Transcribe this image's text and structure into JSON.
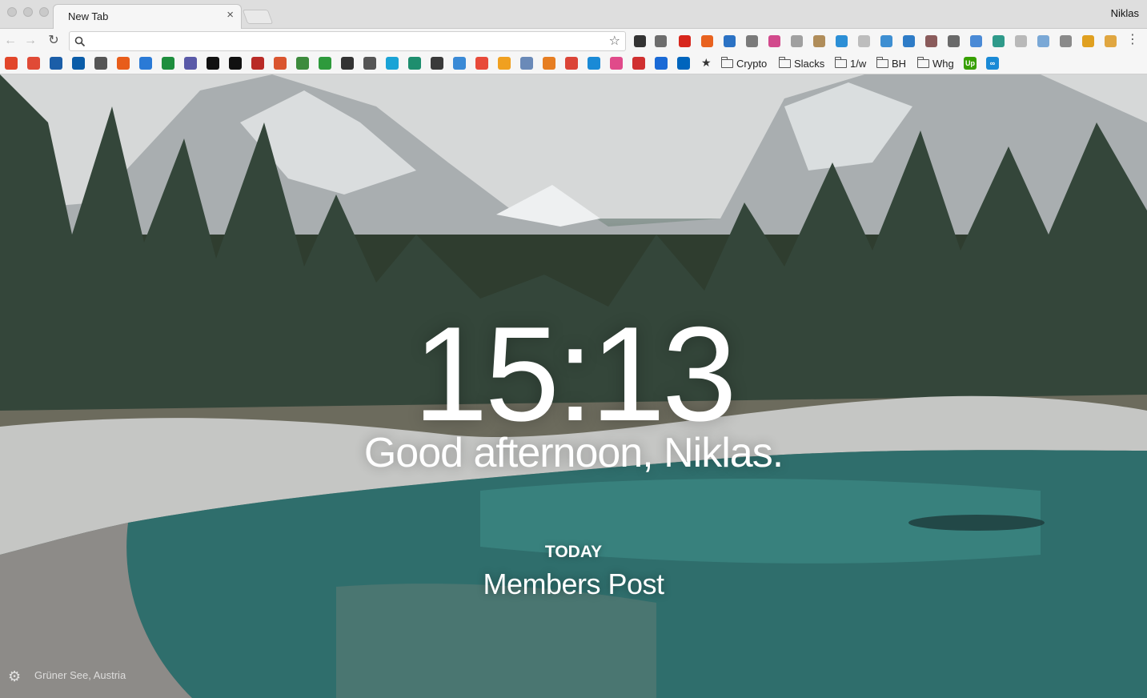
{
  "window": {
    "tab_title": "New Tab",
    "tab_close": "×",
    "profile_name": "Niklas"
  },
  "toolbar": {
    "back": "←",
    "forward": "→",
    "reload": "↻",
    "address_value": "",
    "address_placeholder": "",
    "bookmark_star": "☆",
    "menu": "⋮",
    "extensions": [
      {
        "name": "buffer-icon",
        "color": "#333333"
      },
      {
        "name": "evernote-icon",
        "color": "#6d6d6d"
      },
      {
        "name": "adblock-plus-icon",
        "color": "#d7261c"
      },
      {
        "name": "avast-icon",
        "color": "#e8621f"
      },
      {
        "name": "pie-icon",
        "color": "#2b72c4"
      },
      {
        "name": "clipper-icon",
        "color": "#7a7a7a"
      },
      {
        "name": "colorpicker-icon",
        "color": "#d24a8c"
      },
      {
        "name": "grammar-icon",
        "color": "#a0a0a0"
      },
      {
        "name": "stamp-icon",
        "color": "#b08d5a"
      },
      {
        "name": "compass-icon",
        "color": "#2c8fd6"
      },
      {
        "name": "page-icon",
        "color": "#bdbdbd"
      },
      {
        "name": "globe-icon",
        "color": "#3e8fd2"
      },
      {
        "name": "screenshot-icon",
        "color": "#2e7cc7"
      },
      {
        "name": "klout-icon",
        "color": "#8a5b5b"
      },
      {
        "name": "dark-circle-icon",
        "color": "#6a6a6a"
      },
      {
        "name": "window-icon",
        "color": "#4a8ad6"
      },
      {
        "name": "graph-icon",
        "color": "#2f9a8a"
      },
      {
        "name": "cloud-icon",
        "color": "#b9b9b9"
      },
      {
        "name": "cast-icon",
        "color": "#7aa8d6"
      },
      {
        "name": "arrow-icon",
        "color": "#8a8a8a"
      },
      {
        "name": "chrome-icon",
        "color": "#e0a020"
      },
      {
        "name": "puzzle-icon",
        "color": "#e0a640"
      }
    ]
  },
  "bookmarks": {
    "icons": [
      {
        "name": "bookmark-refresh-icon",
        "color": "#e2462a"
      },
      {
        "name": "bookmark-red-app-icon",
        "color": "#e04a36"
      },
      {
        "name": "bookmark-dkb-icon",
        "color": "#1b5ea8"
      },
      {
        "name": "bookmark-volksbank-icon",
        "color": "#0a5ca8"
      },
      {
        "name": "bookmark-document-icon",
        "color": "#555555"
      },
      {
        "name": "bookmark-link-icon",
        "color": "#e85d1a"
      },
      {
        "name": "bookmark-grid-icon",
        "color": "#2a7ad6"
      },
      {
        "name": "bookmark-sheets-icon",
        "color": "#1e8e3e"
      },
      {
        "name": "bookmark-calc-icon",
        "color": "#5a5aa8"
      },
      {
        "name": "bookmark-p-icon",
        "color": "#111111"
      },
      {
        "name": "bookmark-medium-icon",
        "color": "#111111"
      },
      {
        "name": "bookmark-quora-icon",
        "color": "#b92b27"
      },
      {
        "name": "bookmark-producthunt-icon",
        "color": "#da552f"
      },
      {
        "name": "bookmark-green-circle-icon",
        "color": "#3d8b3d"
      },
      {
        "name": "bookmark-frog-icon",
        "color": "#2e9a3c"
      },
      {
        "name": "bookmark-check-icon",
        "color": "#333333"
      },
      {
        "name": "bookmark-inbox-icon",
        "color": "#555555"
      },
      {
        "name": "bookmark-c-icon",
        "color": "#1aa3d6"
      },
      {
        "name": "bookmark-leaf-icon",
        "color": "#1e8e6e"
      },
      {
        "name": "bookmark-mailchimp-icon",
        "color": "#3a3a3a"
      },
      {
        "name": "bookmark-cube-icon",
        "color": "#3a8ad6"
      },
      {
        "name": "bookmark-todo-icon",
        "color": "#e84a3a"
      },
      {
        "name": "bookmark-bars-icon",
        "color": "#f0a020"
      },
      {
        "name": "bookmark-house-icon",
        "color": "#6a8ab8"
      },
      {
        "name": "bookmark-color-ball-icon",
        "color": "#e67e22"
      },
      {
        "name": "bookmark-g-icon",
        "color": "#db4437"
      },
      {
        "name": "bookmark-dot-icon",
        "color": "#1a8ad6"
      },
      {
        "name": "bookmark-tiles-icon",
        "color": "#e04a8a"
      },
      {
        "name": "bookmark-gift-icon",
        "color": "#d03030"
      },
      {
        "name": "bookmark-half-moon-icon",
        "color": "#1a6ad6"
      },
      {
        "name": "bookmark-tum-icon",
        "color": "#0065bd"
      }
    ],
    "folders": [
      {
        "label": "Crypto"
      },
      {
        "label": "Slacks"
      },
      {
        "label": "1/w"
      },
      {
        "label": "BH"
      },
      {
        "label": "Whg"
      }
    ],
    "trailing": [
      {
        "name": "bookmark-upwork-icon",
        "color": "#37a000",
        "text": "Up"
      },
      {
        "name": "bookmark-infinity-icon",
        "color": "#1a8ad6",
        "text": "∞"
      }
    ]
  },
  "momentum": {
    "time": "15:13",
    "greeting": "Good afternoon, Niklas.",
    "focus_label": "TODAY",
    "focus_value": "Members Post",
    "photo_location": "Grüner See, Austria"
  }
}
